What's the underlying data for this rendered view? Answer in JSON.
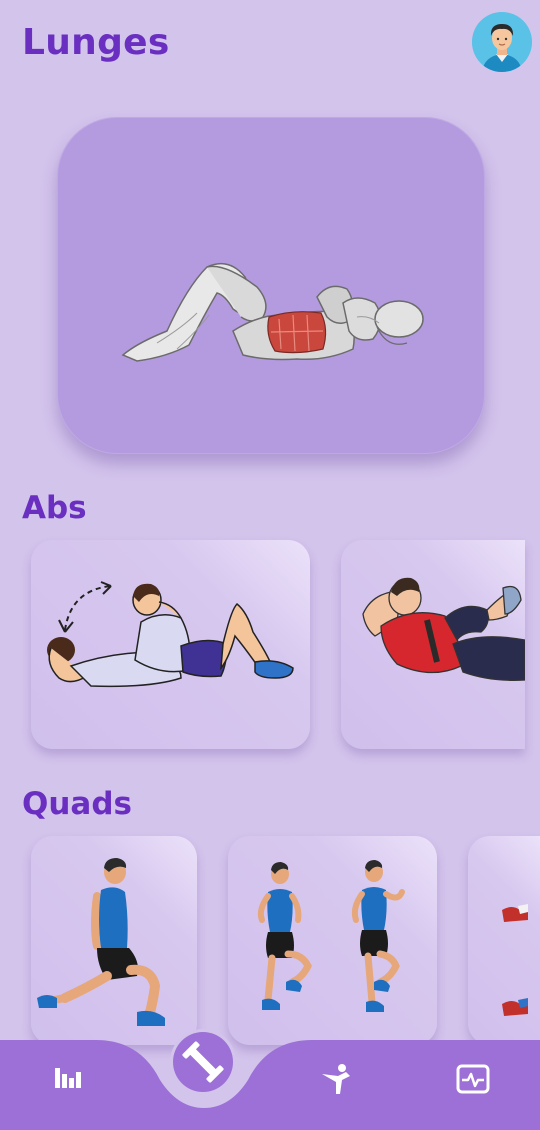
{
  "header": {
    "title": "Lunges",
    "avatar_icon": "user-avatar-icon"
  },
  "hero": {
    "image_icon": "crunch-anatomy-illustration"
  },
  "sections": [
    {
      "title": "Abs",
      "cards": [
        {
          "image_icon": "crunch-illustration"
        },
        {
          "image_icon": "bicycle-crunch-illustration"
        }
      ]
    },
    {
      "title": "Quads",
      "cards": [
        {
          "image_icon": "lunge-illustration"
        },
        {
          "image_icon": "high-knees-illustration"
        },
        {
          "image_icon": "sneakers-illustration"
        }
      ]
    }
  ],
  "bottom_nav": {
    "items": [
      {
        "icon": "bar-chart-icon"
      },
      {
        "icon": "dumbbell-icon",
        "active": true
      },
      {
        "icon": "martial-arts-icon"
      },
      {
        "icon": "activity-monitor-icon"
      }
    ]
  },
  "colors": {
    "background": "#d3c4ec",
    "accent": "#6a2fc0",
    "nav": "#9c70d6",
    "hero": "#b49be0"
  }
}
